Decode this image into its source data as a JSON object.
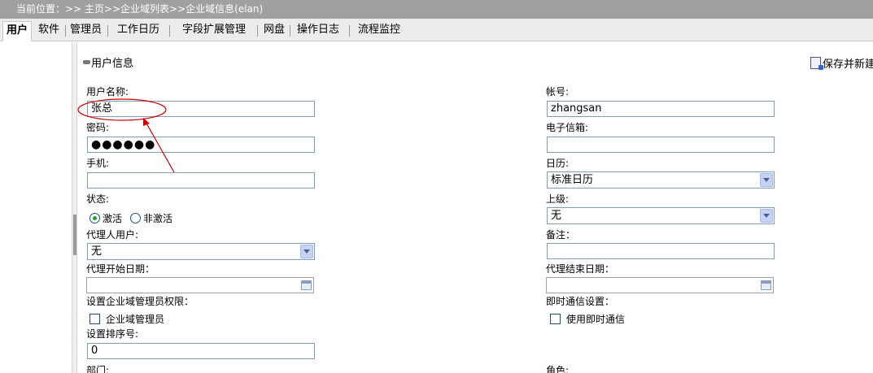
{
  "breadcrumb": "当前位置：>> 主页>>企业域列表>>企业域信息(elan)",
  "tabs": [
    "用户",
    "软件",
    "管理员",
    "工作日历",
    "字段扩展管理",
    "网盘",
    "操作日志",
    "流程监控"
  ],
  "active_tab": "用户",
  "section_title": "用户信息",
  "save_button": "保存并新建",
  "fields": {
    "username_label": "用户名称:",
    "username_value": "张总",
    "account_label": "帐号:",
    "account_value": "zhangsan",
    "password_label": "密码:",
    "password_value": "●●●●●●",
    "email_label": "电子信箱:",
    "email_value": "",
    "mobile_label": "手机:",
    "mobile_value": "",
    "calendar_label": "日历:",
    "calendar_value": "标准日历",
    "status_label": "状态:",
    "status_active": "激活",
    "status_inactive": "非激活",
    "superior_label": "上级:",
    "superior_value": "无",
    "proxy_user_label": "代理人用户:",
    "proxy_user_value": "无",
    "remark_label": "备注：",
    "remark_value": "",
    "proxy_start_label": "代理开始日期：",
    "proxy_start_value": "",
    "proxy_end_label": "代理结束日期：",
    "proxy_end_value": "",
    "admin_perm_label": "设置企业域管理员权限：",
    "admin_checkbox": "企业域管理员",
    "im_label": "即时通信设置：",
    "im_checkbox": "使用即时通信",
    "sort_label": "设置排序号:",
    "sort_value": "0",
    "dept_label": "部门:",
    "role_label": "角色:"
  },
  "annotation_color": "#cc0000"
}
